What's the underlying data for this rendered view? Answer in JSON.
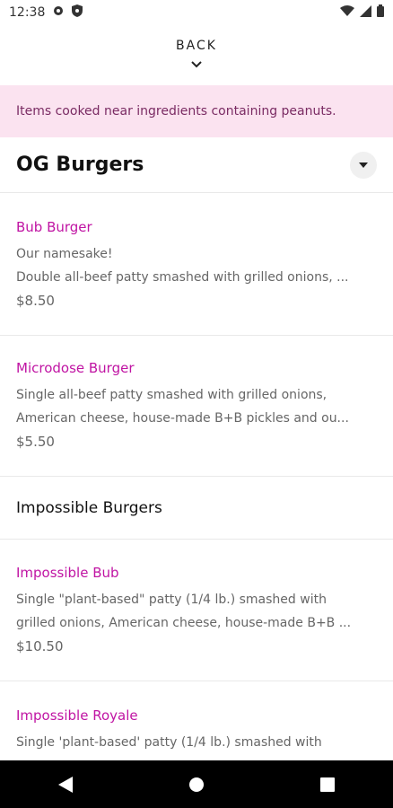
{
  "status_bar": {
    "time": "12:38",
    "icons_left": [
      "gear-icon",
      "shield-icon"
    ],
    "icons_right": [
      "wifi-icon",
      "signal-icon",
      "battery-icon"
    ]
  },
  "header": {
    "back_label": "BACK"
  },
  "allergen_notice": "Items cooked near ingredients containing peanuts.",
  "section": {
    "title": "OG Burgers"
  },
  "items": [
    {
      "name": "Bub Burger",
      "desc_lines": [
        "Our namesake!",
        "Double all-beef patty smashed with grilled onions, ..."
      ],
      "price": "$8.50"
    },
    {
      "name": "Microdose Burger",
      "desc_lines": [
        "Single all-beef patty smashed with grilled onions,",
        "American cheese, house-made B+B pickles and ou..."
      ],
      "price": "$5.50"
    }
  ],
  "subsection": {
    "title": "Impossible Burgers"
  },
  "impossible_items": [
    {
      "name": "Impossible Bub",
      "desc_lines": [
        "Single \"plant-based\" patty (1/4 lb.) smashed with",
        "grilled onions, American cheese, house-made B+B ..."
      ],
      "price": "$10.50"
    },
    {
      "name": "Impossible Royale",
      "desc_lines": [
        "Single 'plant-based' patty (1/4 lb.) smashed with"
      ],
      "price": ""
    }
  ],
  "colors": {
    "accent": "#c014a3",
    "banner_bg": "#fbe3f0",
    "nav_bar": "#000000"
  }
}
